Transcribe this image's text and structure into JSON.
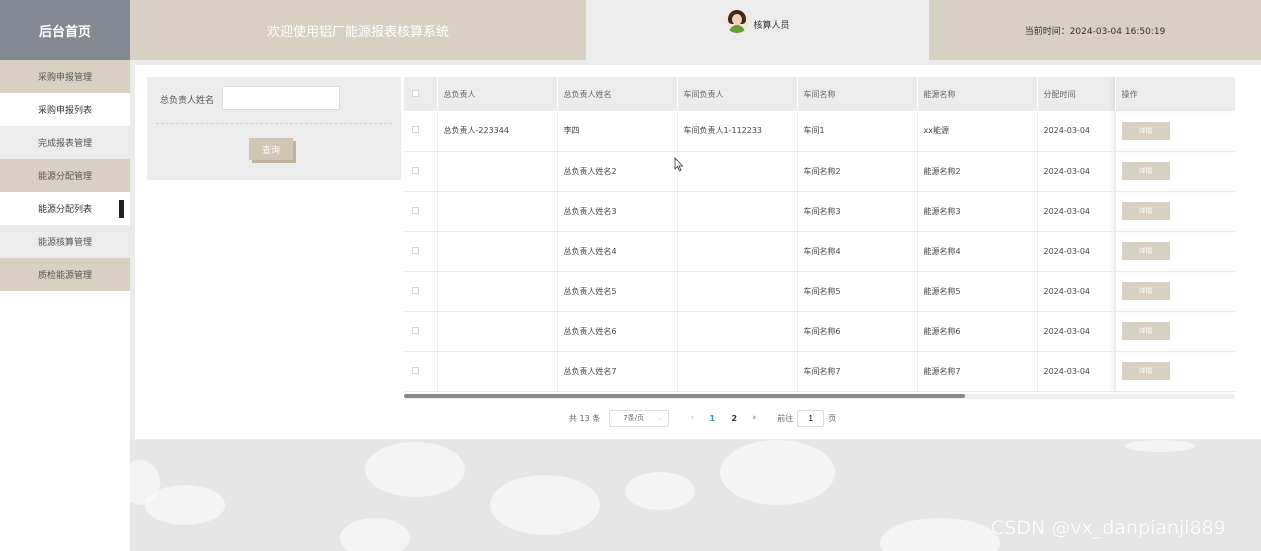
{
  "header": {
    "logo_text": "后台首页",
    "welcome_text": "欢迎使用铝厂能源报表核算系统",
    "user_name": "核算人员",
    "current_time": "当前时间：2024-03-04 16:50:19"
  },
  "sidebar": {
    "items": [
      {
        "label": "采购申报管理",
        "type": "group"
      },
      {
        "label": "采购申报列表",
        "type": "sub"
      },
      {
        "label": "完成报表管理",
        "type": "group"
      },
      {
        "label": "能源分配管理",
        "type": "group"
      },
      {
        "label": "能源分配列表",
        "type": "sub"
      },
      {
        "label": "能源核算管理",
        "type": "group"
      },
      {
        "label": "质检能源管理",
        "type": "group"
      }
    ]
  },
  "search": {
    "label": "总负责人姓名",
    "value": "",
    "button_label": "查询"
  },
  "table": {
    "headers": [
      "总负责人",
      "总负责人姓名",
      "车间负责人",
      "车间名称",
      "能源名称",
      "分配时间",
      "操作"
    ],
    "action_label": "详情",
    "rows": [
      [
        "总负责人-223344",
        "李四",
        "车间负责人1-112233",
        "车间1",
        "xx能源",
        "2024-03-04"
      ],
      [
        "",
        "总负责人姓名2",
        "",
        "车间名称2",
        "能源名称2",
        "2024-03-04"
      ],
      [
        "",
        "总负责人姓名3",
        "",
        "车间名称3",
        "能源名称3",
        "2024-03-04"
      ],
      [
        "",
        "总负责人姓名4",
        "",
        "车间名称4",
        "能源名称4",
        "2024-03-04"
      ],
      [
        "",
        "总负责人姓名5",
        "",
        "车间名称5",
        "能源名称5",
        "2024-03-04"
      ],
      [
        "",
        "总负责人姓名6",
        "",
        "车间名称6",
        "能源名称6",
        "2024-03-04"
      ],
      [
        "",
        "总负责人姓名7",
        "",
        "车间名称7",
        "能源名称7",
        "2024-03-04"
      ]
    ]
  },
  "pagination": {
    "total_text": "共 13 条",
    "page_size_text": "7条/页",
    "pages": [
      "1",
      "2"
    ],
    "current_page": "1",
    "jump_prefix": "前往",
    "jump_value": "1",
    "jump_suffix": "页"
  },
  "watermark": "CSDN @vx_danpianji889"
}
